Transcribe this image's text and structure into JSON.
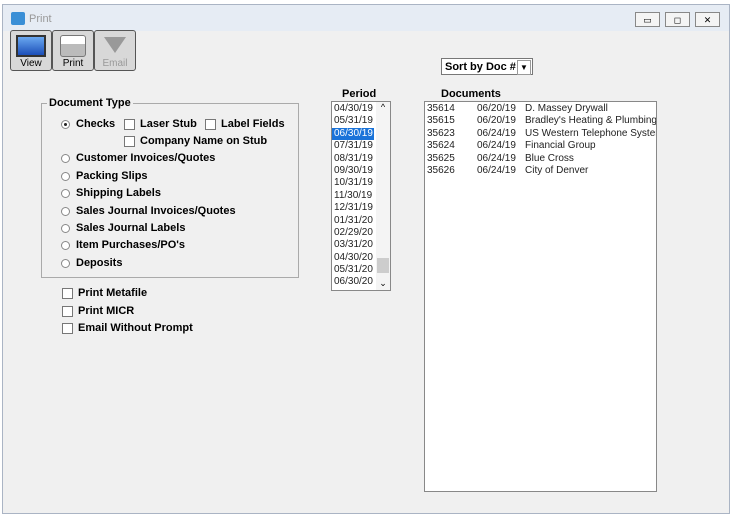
{
  "window": {
    "title": "Print",
    "controls": {
      "minimize": "▭",
      "maximize": "◻",
      "close": "✕"
    }
  },
  "toolbar": [
    {
      "label": "View",
      "icon": "monitor-icon",
      "enabled": true
    },
    {
      "label": "Print",
      "icon": "printer-icon",
      "enabled": true
    },
    {
      "label": "Email",
      "icon": "email-icon",
      "enabled": false
    }
  ],
  "document_type": {
    "legend": "Document Type",
    "options": [
      "Checks",
      "Customer Invoices/Quotes",
      "Packing Slips",
      "Shipping Labels",
      "Sales Journal Invoices/Quotes",
      "Sales Journal Labels",
      "Item Purchases/PO's",
      "Deposits"
    ],
    "selected": "Checks",
    "check_options": {
      "laser_stub": "Laser Stub",
      "label_fields": "Label Fields",
      "company_name": "Company Name on Stub"
    }
  },
  "extra_options": [
    "Print Metafile",
    "Print MICR",
    "Email Without Prompt"
  ],
  "sort": {
    "value": "Sort by Doc #"
  },
  "period": {
    "header": "Period",
    "items": [
      "04/30/19",
      "05/31/19",
      "06/30/19",
      "07/31/19",
      "08/31/19",
      "09/30/19",
      "10/31/19",
      "11/30/19",
      "12/31/19",
      "01/31/20",
      "02/29/20",
      "03/31/20",
      "04/30/20",
      "05/31/20",
      "06/30/20"
    ],
    "selected": "06/30/19"
  },
  "documents": {
    "header": "Documents",
    "rows": [
      [
        "35614",
        "06/20/19",
        "D. Massey Drywall"
      ],
      [
        "35615",
        "06/20/19",
        "Bradley's Heating & Plumbing"
      ],
      [
        "35623",
        "06/24/19",
        "US Western Telephone System"
      ],
      [
        "35624",
        "06/24/19",
        "Financial Group"
      ],
      [
        "35625",
        "06/24/19",
        "Blue Cross"
      ],
      [
        "35626",
        "06/24/19",
        "City of Denver"
      ]
    ]
  },
  "colors": {
    "selection": "#1a73d9"
  }
}
